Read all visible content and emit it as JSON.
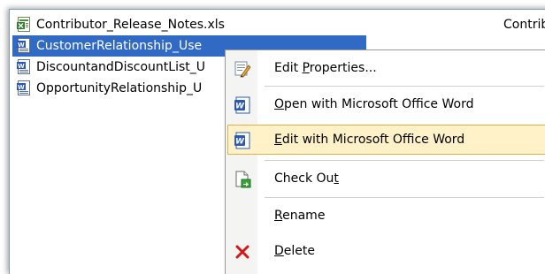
{
  "files": [
    {
      "name": "Contributor_Release_Notes.xls",
      "owner": "Contribu",
      "icon": "excel-file-icon",
      "selected": false
    },
    {
      "name": "CustomerRelationship_Use",
      "icon": "word-file-icon",
      "selected": true
    },
    {
      "name": "DiscountandDiscountList_U",
      "icon": "word-file-icon",
      "selected": false
    },
    {
      "name": "OpportunityRelationship_U",
      "icon": "word-file-icon",
      "selected": false
    }
  ],
  "menu": {
    "edit_properties": {
      "pre": "Edit ",
      "key": "P",
      "post": "roperties..."
    },
    "open_word": {
      "pre": "",
      "key": "O",
      "post": "pen with Microsoft Office Word"
    },
    "edit_word": {
      "pre": "",
      "key": "E",
      "post": "dit with Microsoft Office Word"
    },
    "check_out": {
      "pre": "Check Ou",
      "key": "t",
      "post": ""
    },
    "rename": {
      "pre": "",
      "key": "R",
      "post": "ename"
    },
    "delete": {
      "pre": "",
      "key": "D",
      "post": "elete"
    }
  },
  "colors": {
    "selection": "#316ac5",
    "menu_highlight": "#fff2c8",
    "menu_highlight_border": "#e3b044",
    "delete_x": "#d01818"
  }
}
